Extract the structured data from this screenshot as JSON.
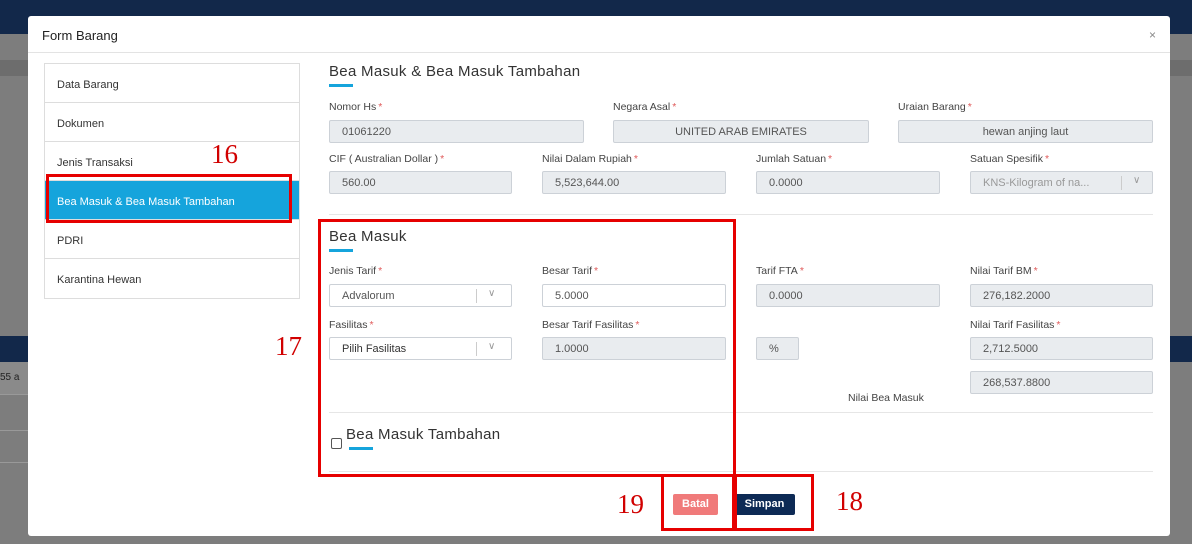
{
  "background": {
    "partial_text": "55 a"
  },
  "modal": {
    "title": "Form Barang",
    "close_glyph": "×"
  },
  "sidebar": {
    "items": [
      {
        "label": "Data Barang"
      },
      {
        "label": "Dokumen"
      },
      {
        "label": "Jenis Transaksi"
      },
      {
        "label": "Bea Masuk & Bea Masuk Tambahan"
      },
      {
        "label": "PDRI"
      },
      {
        "label": "Karantina Hewan"
      }
    ],
    "active_index": 3
  },
  "header_section": {
    "title": "Bea Masuk & Bea Masuk Tambahan",
    "nomor_hs": {
      "label": "Nomor Hs",
      "value": "01061220"
    },
    "negara_asal": {
      "label": "Negara Asal",
      "value": "UNITED ARAB EMIRATES"
    },
    "uraian_barang": {
      "label": "Uraian Barang",
      "value": "hewan anjing laut"
    },
    "cif": {
      "label": "CIF ( Australian Dollar )",
      "value": "560.00"
    },
    "nilai_rupiah": {
      "label": "Nilai Dalam Rupiah",
      "value": "5,523,644.00"
    },
    "jumlah_satuan": {
      "label": "Jumlah Satuan",
      "value": "0.0000"
    },
    "satuan_spesifik": {
      "label": "Satuan Spesifik",
      "value": "KNS-Kilogram of na..."
    }
  },
  "bea_masuk": {
    "title": "Bea Masuk",
    "jenis_tarif": {
      "label": "Jenis Tarif",
      "value": "Advalorum"
    },
    "besar_tarif": {
      "label": "Besar Tarif",
      "value": "5.0000"
    },
    "tarif_fta": {
      "label": "Tarif FTA",
      "value": "0.0000"
    },
    "nilai_tarif_bm": {
      "label": "Nilai Tarif BM",
      "value": "276,182.2000"
    },
    "fasilitas": {
      "label": "Fasilitas",
      "value": "Pilih Fasilitas"
    },
    "besar_tarif_fasilitas": {
      "label": "Besar Tarif Fasilitas",
      "value": "1.0000"
    },
    "percent_unit": "%",
    "nilai_tarif_fasilitas": {
      "label": "Nilai Tarif Fasilitas",
      "value": "2,712.5000"
    },
    "nilai_bea_masuk": {
      "label": "Nilai Bea Masuk",
      "value": "268,537.8800"
    }
  },
  "bea_masuk_tambahan": {
    "title": "Bea Masuk Tambahan",
    "checked": false
  },
  "buttons": {
    "batal": "Batal",
    "simpan": "Simpan"
  },
  "required_mark": "*",
  "annotations": {
    "n16": "16",
    "n17": "17",
    "n18": "18",
    "n19": "19",
    "color": "#e60000"
  }
}
